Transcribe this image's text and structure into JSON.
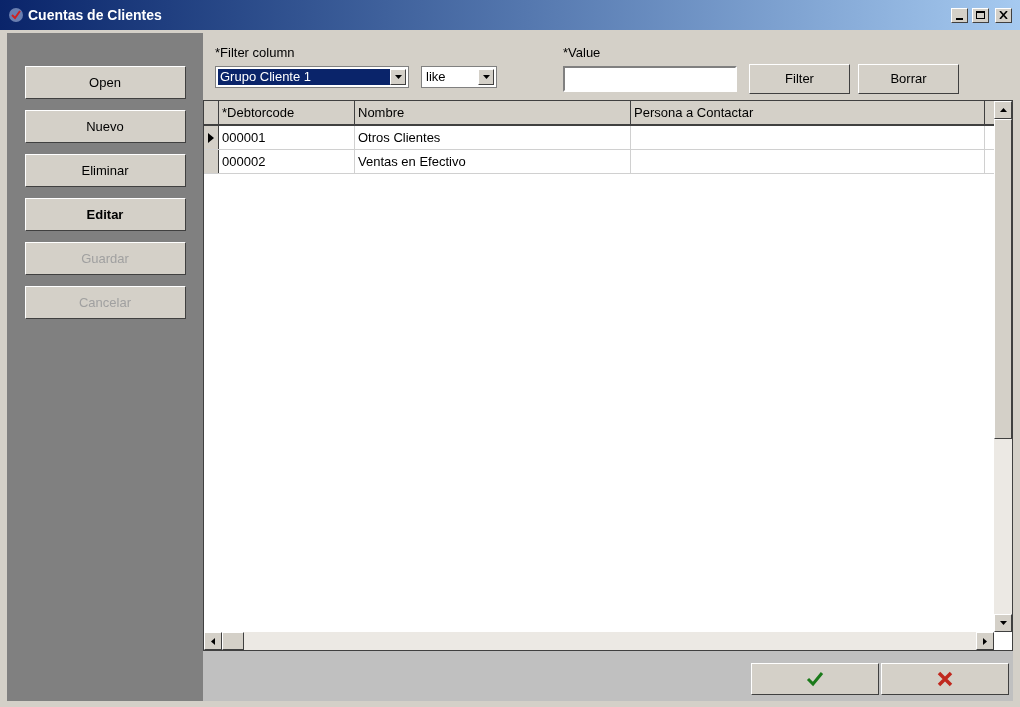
{
  "window": {
    "title": "Cuentas de Clientes"
  },
  "side_buttons": [
    {
      "label": "Open",
      "disabled": false,
      "default": false
    },
    {
      "label": "Nuevo",
      "disabled": false,
      "default": false
    },
    {
      "label": "Eliminar",
      "disabled": false,
      "default": false
    },
    {
      "label": "Editar",
      "disabled": false,
      "default": true
    },
    {
      "label": "Guardar",
      "disabled": true,
      "default": false
    },
    {
      "label": "Cancelar",
      "disabled": true,
      "default": false
    }
  ],
  "filter": {
    "column_label": "*Filter column",
    "column_value": "Grupo Cliente 1",
    "operator": "like",
    "value_label": "*Value",
    "buttons": [
      "Filter",
      "Borrar"
    ]
  },
  "table": {
    "columns": [
      "*Debtorcode",
      "Nombre",
      "Persona a Contactar"
    ],
    "rows": [
      {
        "selected": true,
        "cells": [
          "000001",
          "Otros Clientes",
          ""
        ]
      },
      {
        "selected": false,
        "cells": [
          "000002",
          "Ventas en Efectivo",
          ""
        ]
      }
    ]
  },
  "footer_buttons": [
    {
      "kind": "ok"
    },
    {
      "kind": "cancel"
    }
  ]
}
